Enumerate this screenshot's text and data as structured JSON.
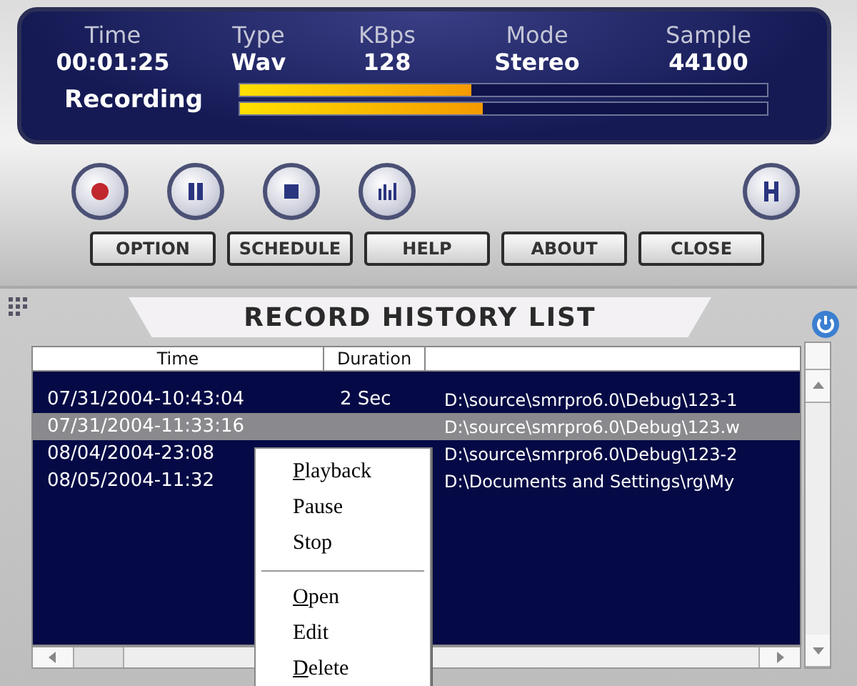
{
  "display": {
    "fields": [
      {
        "label": "Time",
        "value": "00:01:25"
      },
      {
        "label": "Type",
        "value": "Wav"
      },
      {
        "label": "KBps",
        "value": "128"
      },
      {
        "label": "Mode",
        "value": "Stereo"
      },
      {
        "label": "Sample",
        "value": "44100"
      }
    ],
    "status": "Recording",
    "meters": [
      {
        "level": 0.44
      },
      {
        "level": 0.46
      }
    ]
  },
  "transport": [
    {
      "kind": "record"
    },
    {
      "kind": "pause"
    },
    {
      "kind": "stop"
    },
    {
      "kind": "levels"
    },
    {
      "kind": "history"
    }
  ],
  "buttons": [
    "OPTION",
    "SCHEDULE",
    "HELP",
    "ABOUT",
    "CLOSE"
  ],
  "history": {
    "title": "RECORD HISTORY LIST",
    "columns": [
      "Time",
      "Duration"
    ],
    "rows": [
      {
        "time": "07/31/2004-10:43:04",
        "duration": "2 Sec",
        "path": "D:\\source\\smrpro6.0\\Debug\\123-1",
        "selected": false
      },
      {
        "time": "07/31/2004-11:33:16",
        "path": "D:\\source\\smrpro6.0\\Debug\\123.w",
        "selected": true
      },
      {
        "time": "08/04/2004-23:08",
        "path": "D:\\source\\smrpro6.0\\Debug\\123-2",
        "selected": false
      },
      {
        "time": "08/05/2004-11:32",
        "path": "D:\\Documents and Settings\\rg\\My",
        "selected": false
      }
    ]
  },
  "context_menu": [
    {
      "kind": "item",
      "label": "Playback",
      "mnemonic": true
    },
    {
      "kind": "item",
      "label": "Pause",
      "mnemonic": false
    },
    {
      "kind": "item",
      "label": "Stop",
      "mnemonic": false
    },
    {
      "kind": "separator"
    },
    {
      "kind": "item",
      "label": "Open",
      "mnemonic": true
    },
    {
      "kind": "item",
      "label": "Edit",
      "mnemonic": false
    },
    {
      "kind": "item",
      "label": "Delete",
      "mnemonic": true
    }
  ]
}
